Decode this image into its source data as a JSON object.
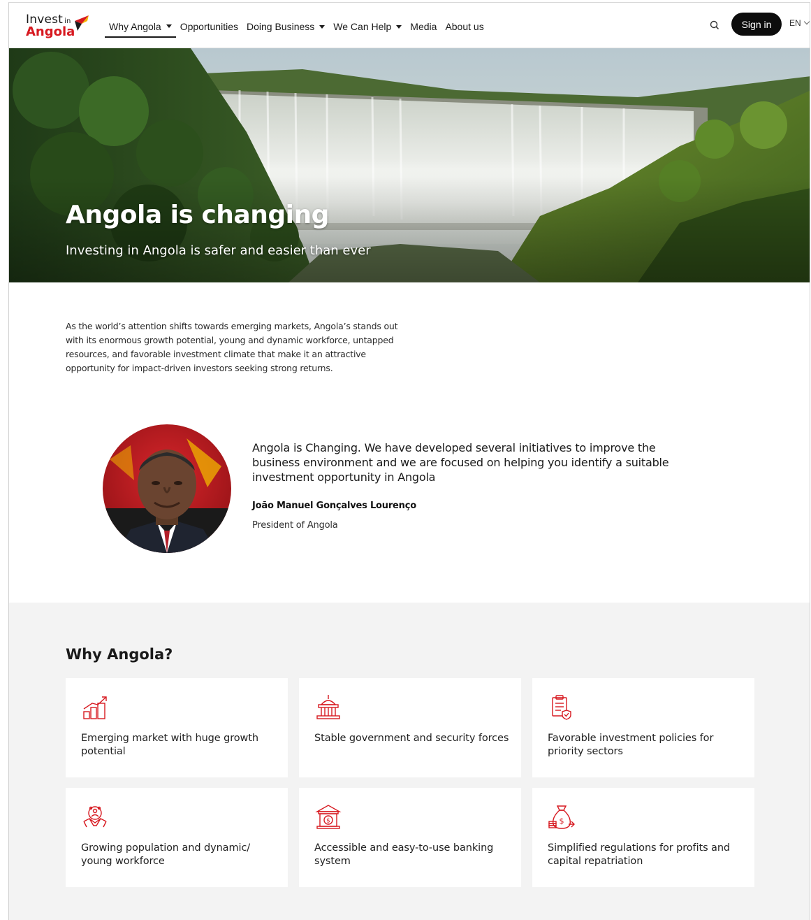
{
  "colors": {
    "brand_red": "#d71920",
    "dark": "#0d0d0d",
    "section_bg": "#f3f3f3"
  },
  "logo": {
    "line1": "Invest",
    "line1_small": "in",
    "line2": "Angola"
  },
  "nav": {
    "items": [
      {
        "label": "Why Angola",
        "dropdown": true,
        "active": true
      },
      {
        "label": "Opportunities",
        "dropdown": false
      },
      {
        "label": "Doing Business",
        "dropdown": true
      },
      {
        "label": "We Can Help",
        "dropdown": true
      },
      {
        "label": "Media",
        "dropdown": false
      },
      {
        "label": "About us",
        "dropdown": false
      }
    ],
    "search_icon": "search-icon",
    "signin_label": "Sign in",
    "language": "EN"
  },
  "hero": {
    "title": "Angola is changing",
    "subtitle": "Investing in Angola is safer and easier than ever"
  },
  "intro": "As the world’s attention shifts towards emerging markets, Angola’s stands out with its enormous growth potential, young and dynamic workforce, untapped resources, and favorable investment climate that make it an attractive opportunity for impact-driven investors seeking strong returns.",
  "quote": {
    "text": "Angola is Changing. We have developed several initiatives to improve the business environment and we are focused on helping you identify a suitable investment opportunity in Angola",
    "name": "João Manuel Gonçalves Lourenço",
    "role": "President of Angola"
  },
  "why": {
    "title": "Why Angola?",
    "cards": [
      {
        "icon": "growth-chart-icon",
        "label": "Emerging market with huge growth potential"
      },
      {
        "icon": "government-building-icon",
        "label": "Stable government and security forces"
      },
      {
        "icon": "policy-document-icon",
        "label": "Favorable investment policies for priority sectors"
      },
      {
        "icon": "handshake-people-icon",
        "label": "Growing population and dynamic/ young workforce"
      },
      {
        "icon": "bank-icon",
        "label": "Accessible and easy-to-use banking system"
      },
      {
        "icon": "money-bag-icon",
        "label": "Simplified regulations for profits and capital repatriation"
      }
    ]
  }
}
